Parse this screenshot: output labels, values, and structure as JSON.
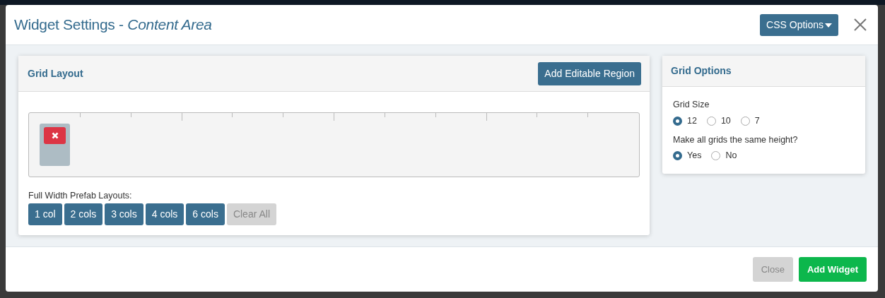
{
  "modal": {
    "title": "Widget Settings - ",
    "title_emphasis": "Content Area",
    "css_button": "CSS Options"
  },
  "grid_layout": {
    "title": "Grid Layout",
    "add_button": "Add Editable Region",
    "regions": [
      {
        "kind": "region"
      }
    ],
    "prefab_label": "Full Width Prefab Layouts:",
    "prefab_buttons": [
      {
        "label": "1 col",
        "disabled": false
      },
      {
        "label": "2 cols",
        "disabled": false
      },
      {
        "label": "3 cols",
        "disabled": false
      },
      {
        "label": "4 cols",
        "disabled": false
      },
      {
        "label": "6 cols",
        "disabled": false
      },
      {
        "label": "Clear All",
        "disabled": true
      }
    ]
  },
  "grid_options": {
    "title": "Grid Options",
    "groups": [
      {
        "label": "Grid Size",
        "options": [
          {
            "label": "12",
            "selected": true
          },
          {
            "label": "10",
            "selected": false
          },
          {
            "label": "7",
            "selected": false
          }
        ]
      },
      {
        "label": "Make all grids the same height?",
        "options": [
          {
            "label": "Yes",
            "selected": true
          },
          {
            "label": "No",
            "selected": false
          }
        ]
      }
    ]
  },
  "footer": {
    "buttons": [
      {
        "label": "Close",
        "kind": "secondary",
        "disabled": true
      },
      {
        "label": "Add Widget",
        "kind": "primary",
        "disabled": false
      }
    ]
  }
}
